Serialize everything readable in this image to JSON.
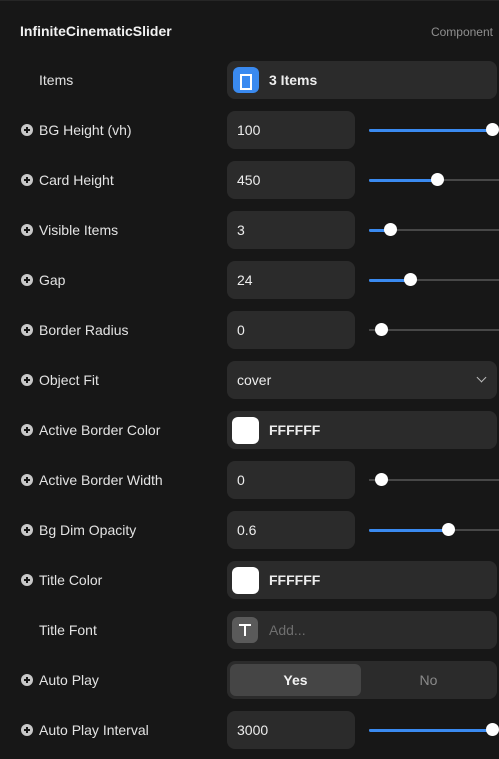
{
  "header": {
    "title": "InfiniteCinematicSlider",
    "tag": "Component"
  },
  "accent_color": "#3a8af0",
  "rows": {
    "items": {
      "label": "Items",
      "icon": "array-icon",
      "value": "3 Items"
    },
    "bg_height": {
      "label": "BG Height (vh)",
      "value": "100",
      "slider_fraction": 1.0
    },
    "card_height": {
      "label": "Card Height",
      "value": "450",
      "slider_fraction": 0.5
    },
    "visible_items": {
      "label": "Visible Items",
      "value": "3",
      "slider_fraction": 0.08
    },
    "gap": {
      "label": "Gap",
      "value": "24",
      "slider_fraction": 0.26
    },
    "border_radius": {
      "label": "Border Radius",
      "value": "0",
      "slider_fraction": 0.0
    },
    "object_fit": {
      "label": "Object Fit",
      "value": "cover"
    },
    "active_border_color": {
      "label": "Active Border Color",
      "value": "FFFFFF",
      "swatch": "#ffffff"
    },
    "active_border_width": {
      "label": "Active Border Width",
      "value": "0",
      "slider_fraction": 0.0
    },
    "bg_dim_opacity": {
      "label": "Bg Dim Opacity",
      "value": "0.6",
      "slider_fraction": 0.6
    },
    "title_color": {
      "label": "Title Color",
      "value": "FFFFFF",
      "swatch": "#ffffff"
    },
    "title_font": {
      "label": "Title Font",
      "placeholder": "Add..."
    },
    "auto_play": {
      "label": "Auto Play",
      "options": [
        "Yes",
        "No"
      ],
      "selected": "Yes"
    },
    "auto_play_interval": {
      "label": "Auto Play Interval",
      "value": "3000",
      "slider_fraction": 1.0
    }
  }
}
